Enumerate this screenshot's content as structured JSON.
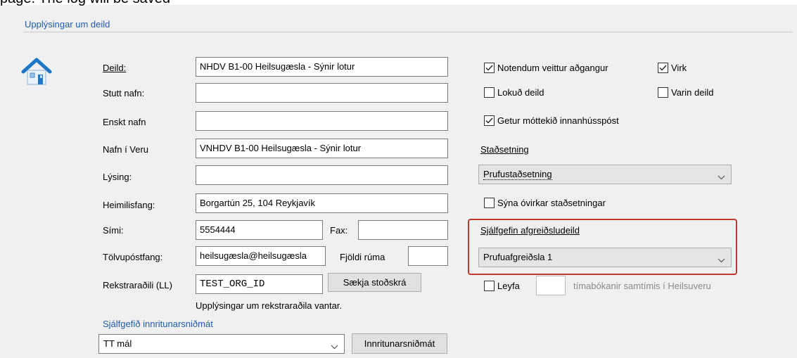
{
  "header": {
    "partial_text": "page. The log will be saved"
  },
  "group": {
    "title": "Upplýsingar um deild"
  },
  "left": {
    "deild_label": "Deild:",
    "deild_value": "NHDV B1-00 Heilsugæsla - Sýnir lotur",
    "stutt_nafn_label": "Stutt nafn:",
    "stutt_nafn_value": "",
    "enskt_nafn_label": "Enskt nafn",
    "enskt_nafn_value": "",
    "nafn_veru_label": "Nafn í Veru",
    "nafn_veru_value": "VNHDV B1-00 Heilsugæsla - Sýnir lotur",
    "lysing_label": "Lýsing:",
    "lysing_value": "",
    "heimilisfang_label": "Heimilisfang:",
    "heimilisfang_value": "Borgartún 25, 104 Reykjavík",
    "simi_label": "Sími:",
    "simi_value": "5554444",
    "fax_label": "Fax:",
    "fax_value": "",
    "tolvupostfang_label": "Tölvupóstfang:",
    "tolvupostfang_value": "heilsugæsla@heilsugæsla",
    "fjoldi_ruma_label": "Fjöldi rúma",
    "fjoldi_ruma_value": "",
    "rekstraradili_label": "Rekstraraðili (LL)",
    "rekstraradili_value": "TEST_ORG_ID",
    "saekja_button": "Sækja stoðskrá",
    "rekstraradili_warning": "Upplýsingar um rekstraraðila vantar.",
    "innritun_label": "Sjálfgefið innritunarsniðmát",
    "innritun_value": "TT mál",
    "innritun_button": "Innritunarsniðmát"
  },
  "right": {
    "notendum_label": "Notendum veittur aðgangur",
    "notendum_checked": true,
    "virk_label": "Virk",
    "virk_checked": true,
    "lokud_label": "Lokuð deild",
    "lokud_checked": false,
    "varin_label": "Varin deild",
    "varin_checked": false,
    "getur_label": "Getur móttekið innanhússpóst",
    "getur_checked": true,
    "stadsetning_label": "Staðsetning",
    "stadsetning_value": "Prufustaðsetning",
    "syna_label": "Sýna óvirkar staðsetningar",
    "syna_checked": false,
    "afgreidsla_label": "Sjálfgefin afgreiðsludeild",
    "afgreidsla_value": "Prufuafgreiðsla 1",
    "leyfa_label": "Leyfa",
    "leyfa_checked": false,
    "leyfa_value": "",
    "timabokanir_label": "tímabókanir samtímis í Heilsuveru"
  },
  "colors": {
    "accent": "#1f5cad",
    "highlight": "#c0392b"
  },
  "icons": {
    "department": "house-icon"
  }
}
